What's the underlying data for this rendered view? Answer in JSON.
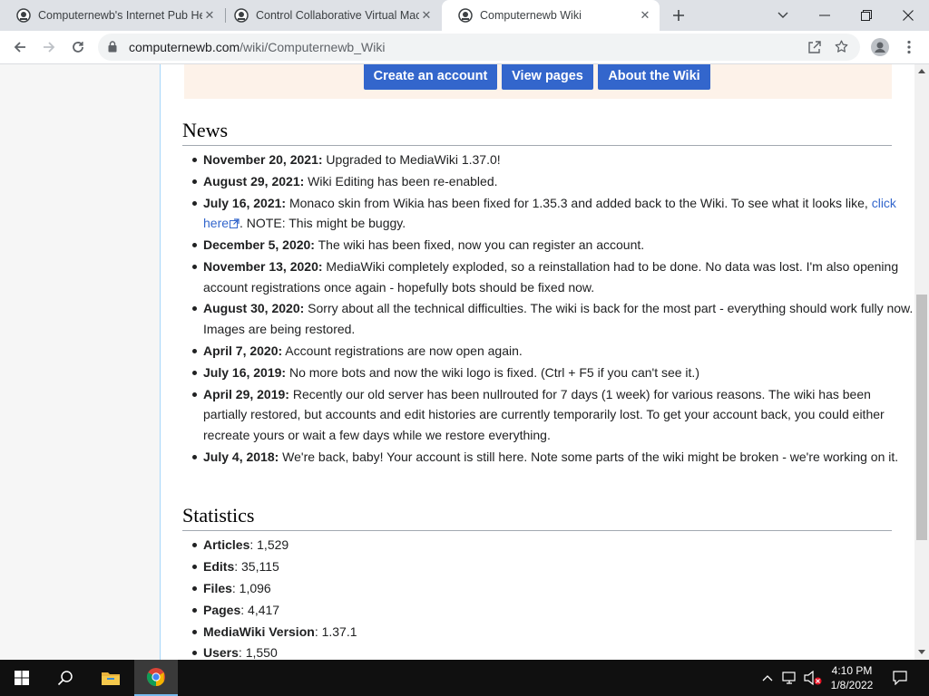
{
  "browser": {
    "tabs": [
      {
        "title": "Computernewb's Internet Pub He",
        "active": false
      },
      {
        "title": "Control Collaborative Virtual Mac",
        "active": false
      },
      {
        "title": "Computernewb Wiki",
        "active": true
      }
    ],
    "url_domain": "computernewb.com",
    "url_path": "/wiki/Computernewb_Wiki"
  },
  "banner": {
    "buttons": [
      "Create an account",
      "View pages",
      "About the Wiki"
    ]
  },
  "news": {
    "heading": "News",
    "items": [
      {
        "date": "November 20, 2021:",
        "text": " Upgraded to MediaWiki 1.37.0!"
      },
      {
        "date": "August 29, 2021:",
        "text": " Wiki Editing has been re-enabled."
      },
      {
        "date": "July 16, 2021:",
        "text": " Monaco skin from Wikia has been fixed for 1.35.3 and added back to the Wiki. To see what it looks like, ",
        "link": "click here",
        "after": ". NOTE: This might be buggy."
      },
      {
        "date": "December 5, 2020:",
        "text": " The wiki has been fixed, now you can register an account."
      },
      {
        "date": "November 13, 2020:",
        "text": " MediaWiki completely exploded, so a reinstallation had to be done. No data was lost. I'm also opening account registrations once again - hopefully bots should be fixed now."
      },
      {
        "date": "August 30, 2020:",
        "text": " Sorry about all the technical difficulties. The wiki is back for the most part - everything should work fully now. Images are being restored."
      },
      {
        "date": "April 7, 2020:",
        "text": " Account registrations are now open again."
      },
      {
        "date": "July 16, 2019:",
        "text": " No more bots and now the wiki logo is fixed. (Ctrl + F5 if you can't see it.)"
      },
      {
        "date": "April 29, 2019:",
        "text": " Recently our old server has been nullrouted for 7 days (1 week) for various reasons. The wiki has been partially restored, but accounts and edit histories are currently temporarily lost. To get your account back, you could either recreate yours or wait a few days while we restore everything."
      },
      {
        "date": "July 4, 2018:",
        "text": " We're back, baby! Your account is still here. Note some parts of the wiki might be broken - we're working on it."
      }
    ]
  },
  "statistics": {
    "heading": "Statistics",
    "items": [
      {
        "label": "Articles",
        "value": ": 1,529"
      },
      {
        "label": "Edits",
        "value": ": 35,115"
      },
      {
        "label": "Files",
        "value": ": 1,096"
      },
      {
        "label": "Pages",
        "value": ": 4,417"
      },
      {
        "label": "MediaWiki Version",
        "value": ": 1.37.1"
      },
      {
        "label": "Users",
        "value": ": 1,550"
      }
    ]
  },
  "taskbar": {
    "time": "4:10 PM",
    "date": "1/8/2022"
  },
  "colors": {
    "link": "#3366cc",
    "button": "#3366cc",
    "banner": "#fdf2e9"
  }
}
